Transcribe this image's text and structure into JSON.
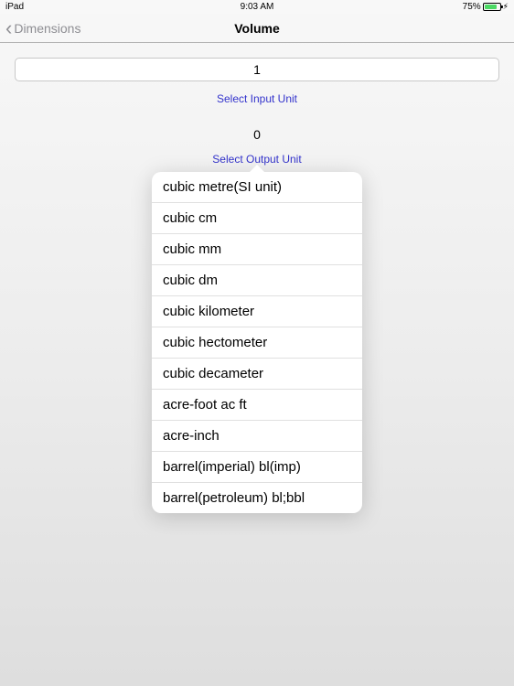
{
  "status": {
    "device": "iPad",
    "time": "9:03 AM",
    "battery_pct": "75%"
  },
  "nav": {
    "back_label": "Dimensions",
    "title": "Volume"
  },
  "input": {
    "value": "1",
    "select_label": "Select Input Unit"
  },
  "output": {
    "value": "0",
    "select_label": "Select Output Unit"
  },
  "popover": {
    "items": [
      "cubic metre(SI unit)",
      "cubic cm",
      "cubic mm",
      "cubic dm",
      "cubic kilometer",
      "cubic hectometer",
      "cubic decameter",
      "acre-foot ac ft",
      "acre-inch",
      "barrel(imperial) bl(imp)",
      "barrel(petroleum) bl;bbl"
    ]
  }
}
